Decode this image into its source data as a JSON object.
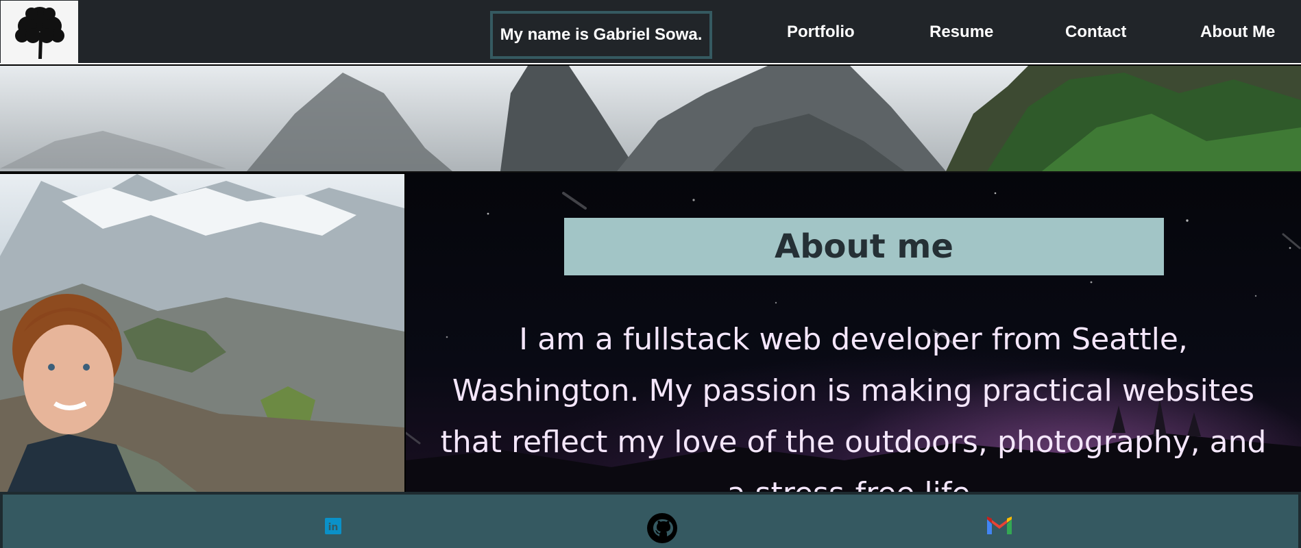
{
  "navbar": {
    "brand": "My name is Gabriel Sowa.",
    "links": [
      {
        "label": "Portfolio"
      },
      {
        "label": "Resume"
      },
      {
        "label": "Contact"
      },
      {
        "label": "About Me"
      }
    ],
    "icons": {
      "logo": "tree-icon"
    }
  },
  "about": {
    "title": "About me",
    "bio": "I am a fullstack web developer from Seattle, Washington. My passion is making practical websites that reflect my love of the outdoors, photography, and a stress-free life."
  },
  "footer": {
    "icons": [
      "linkedin-icon",
      "github-icon",
      "gmail-icon"
    ]
  },
  "colors": {
    "navbar_bg": "#212529",
    "brand_border": "#355a61",
    "about_box": "#a2c5c6",
    "footer_bg": "#355961",
    "bio_text": "#f4e6fb"
  }
}
